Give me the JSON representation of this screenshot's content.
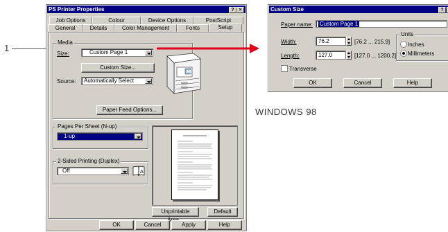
{
  "callout": {
    "number": "1"
  },
  "left_dialog": {
    "title": "PS Printer Properties",
    "title_buttons": [
      "?",
      "×"
    ],
    "tabs_row1": [
      "Job Options",
      "Colour",
      "Device Options",
      "PostScript"
    ],
    "tabs_row2": [
      "General",
      "Details",
      "Color Management",
      "Fonts",
      "Setup"
    ],
    "media": {
      "legend": "Media",
      "size_label": "Size:",
      "size_value": "Custom Page 1",
      "custom_size_button": "Custom Size...",
      "source_label": "Source:",
      "source_value": "Automatically Select",
      "paper_feed_button": "Paper Feed Options..."
    },
    "nup": {
      "legend": "Pages Per Sheet (N-up)",
      "value": "1-up"
    },
    "duplex": {
      "legend": "2-Sided Printing (Duplex)",
      "value": "Off"
    },
    "unprintable_button": "Unprintable Area...",
    "default_button": "Default",
    "bottom_buttons": [
      "OK",
      "Cancel",
      "Apply",
      "Help"
    ]
  },
  "right_dialog": {
    "title": "Custom Size",
    "title_buttons": [
      "?",
      "×"
    ],
    "paper_name_label": "Paper name:",
    "paper_name_value": "Custom Page 1",
    "width_label": "Width:",
    "width_value": "76.2",
    "width_range": "[76.2 ... 215.9]",
    "length_label": "Length:",
    "length_value": "127.0",
    "length_range": "[127.0 ... 1200.2]",
    "units_legend": "Units",
    "unit_inches": "Inches",
    "unit_mm": "Millimeters",
    "transverse_label": "Transverse",
    "buttons": [
      "OK",
      "Cancel",
      "Help"
    ]
  },
  "caption": "WINDOWS 98",
  "colors": {
    "arrow": "#e2001a",
    "titlebar": "#000080",
    "dialog": "#d4d0c8"
  }
}
